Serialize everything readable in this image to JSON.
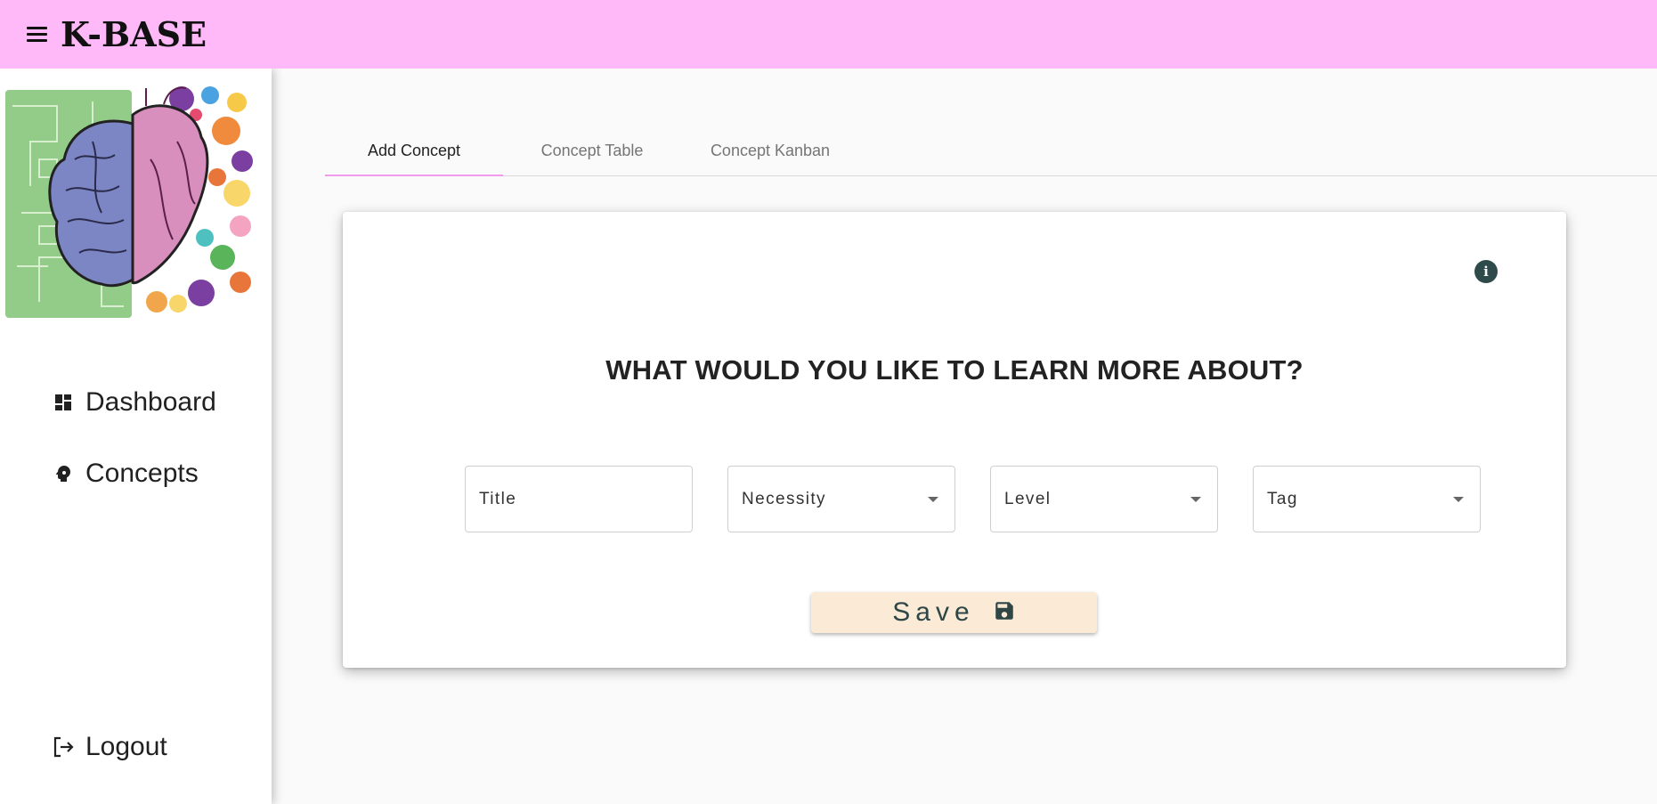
{
  "app": {
    "brand": "K-BASE"
  },
  "sidebar": {
    "items": [
      {
        "label": "Dashboard",
        "icon": "dashboard-icon"
      },
      {
        "label": "Concepts",
        "icon": "psychology-icon"
      }
    ],
    "logout_label": "Logout",
    "logout_icon": "logout-icon",
    "logo": "brain-heart-logo"
  },
  "tabs": [
    {
      "label": "Add Concept",
      "active": true
    },
    {
      "label": "Concept Table",
      "active": false
    },
    {
      "label": "Concept Kanban",
      "active": false
    }
  ],
  "form": {
    "heading": "WHAT WOULD YOU LIKE TO LEARN MORE ABOUT?",
    "info_icon_text": "i",
    "fields": {
      "title": {
        "label": "Title",
        "type": "text"
      },
      "necessity": {
        "label": "Necessity",
        "type": "select"
      },
      "level": {
        "label": "Level",
        "type": "select"
      },
      "tag": {
        "label": "Tag",
        "type": "select"
      }
    },
    "save_label": "Save",
    "save_icon": "floppy-disk-icon"
  },
  "colors": {
    "topbar": "#ffb8f8",
    "tab_indicator": "#f29af0",
    "save_button": "#fbead6",
    "icon_dark": "#2e4a4a"
  }
}
